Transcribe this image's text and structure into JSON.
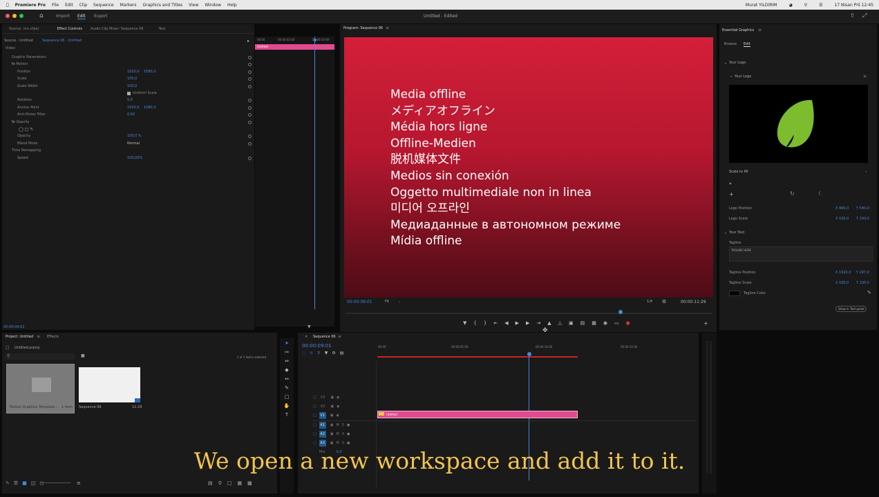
{
  "macbar": {
    "app": "Premiere Pro",
    "menus": [
      "File",
      "Edit",
      "Clip",
      "Sequence",
      "Markers",
      "Graphics and Titles",
      "View",
      "Window",
      "Help"
    ],
    "user": "Murat YILDIRIM",
    "datetime": "17 Nisan Prš  12:45"
  },
  "workspace": {
    "tabs": [
      "Import",
      "Edit",
      "Export"
    ],
    "doc_title": "Untitled",
    "doc_state": "Edited"
  },
  "effect_controls": {
    "tabs": [
      "Source: (no clips)",
      "Effect Controls",
      "Audio Clip Mixer: Sequence 06",
      "Text"
    ],
    "source_label": "Source · Untitled",
    "sequence_label": "Sequence 06 · Untitled",
    "section_video": "Video",
    "rows": [
      {
        "label": "Graphic Parameters",
        "v1": "",
        "v2": ""
      },
      {
        "label": "Motion",
        "v1": "",
        "v2": ""
      },
      {
        "label": "Position",
        "v1": "1920,0",
        "v2": "1080,0"
      },
      {
        "label": "Scale",
        "v1": "100,0",
        "v2": ""
      },
      {
        "label": "Scale Width",
        "v1": "100,0",
        "v2": ""
      },
      {
        "label": "Uniform Scale",
        "v1": "",
        "v2": ""
      },
      {
        "label": "Rotation",
        "v1": "0,0",
        "v2": ""
      },
      {
        "label": "Anchor Point",
        "v1": "1920,0",
        "v2": "1080,0"
      },
      {
        "label": "Anti-flicker Filter",
        "v1": "0,00",
        "v2": ""
      },
      {
        "label": "Opacity",
        "v1": "",
        "v2": ""
      },
      {
        "label": "",
        "v1": "",
        "v2": ""
      },
      {
        "label": "Opacity",
        "v1": "100,0 %",
        "v2": ""
      },
      {
        "label": "Blend Mode",
        "v1": "Normal",
        "v2": ""
      },
      {
        "label": "Time Remapping",
        "v1": "",
        "v2": ""
      },
      {
        "label": "Speed",
        "v1": "100,00%",
        "v2": ""
      }
    ],
    "mini_ruler": [
      "00:00",
      "00:00:05:00",
      "00:00:10:00"
    ],
    "mini_clip": "Untitled",
    "timecode": "00:00:09:01"
  },
  "program": {
    "tab": "Program: Sequence 06",
    "offline_lines": [
      "Media offline",
      "メディアオフライン",
      "Média hors ligne",
      "Offline-Medien",
      "脱机媒体文件",
      "Medios sin conexión",
      "Oggetto multimediale non in linea",
      "미디어 오프라인",
      "Медиаданные в автономном режиме",
      "Mídia offline"
    ],
    "timecode_left": "00:00:09:01",
    "fit": "Fit",
    "resolution": "1/4",
    "timecode_right": "00:00:11:29"
  },
  "project": {
    "tabs": [
      "Project: Untitled",
      "Effects"
    ],
    "file": "Untitled.prproj",
    "items_count": "1 of 1 items selected",
    "bins": [
      {
        "name": "Motion Graphics Template...",
        "meta": "1 item"
      },
      {
        "name": "Sequence 06",
        "meta": "11:29"
      }
    ]
  },
  "timeline": {
    "tab": "Sequence 06",
    "timecode": "00:00:09:01",
    "ruler": [
      "00:00",
      "00:00:05:00",
      "00:00:10:00",
      "00:00:15:00"
    ],
    "video_tracks": [
      "V3",
      "V2",
      "V1"
    ],
    "audio_tracks": [
      "A1",
      "A2",
      "A3"
    ],
    "clip": "Untitled",
    "mix": "Mix",
    "mix_val": "0,0"
  },
  "essential_graphics": {
    "title": "Essential Graphics",
    "tabs": [
      "Browse",
      "Edit"
    ],
    "section_logo": "Your Logo",
    "sub_logo": "Your Logo",
    "scale_to_fill": "Scale to fill",
    "logo_position_label": "Logo Position",
    "logo_position": [
      "X 960,0",
      "Y 540,0"
    ],
    "logo_scale_label": "Logo Scale",
    "logo_scale": [
      "X 100,0",
      "Y 100,0"
    ],
    "section_text": "Your Text",
    "tagline_label": "Tagline",
    "tagline_text": "TAGLINE HERE",
    "tagline_position_label": "Tagline Position",
    "tagline_position": [
      "X 1920,0",
      "Y 297,0"
    ],
    "tagline_scale_label": "Tagline Scale",
    "tagline_scale": [
      "X 100,0",
      "Y 100,0"
    ],
    "tagline_color": "Tagline Color",
    "show_text_panel": "Show in Text panel",
    "logo_color": "#7dbb2f"
  },
  "subtitle": "We open a new workspace and add it to it."
}
